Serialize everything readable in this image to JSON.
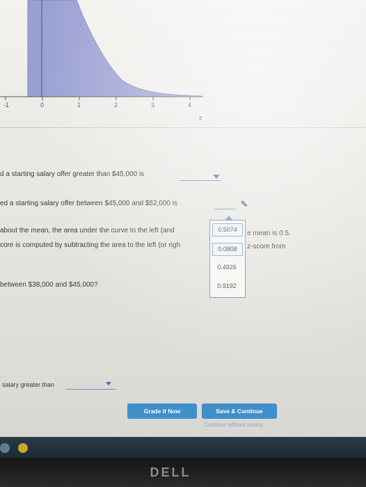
{
  "chart": {
    "tick_labels": [
      "-1",
      "0",
      "1",
      "2",
      "3",
      "4"
    ],
    "axis_var": "z",
    "fill_color": "#9aa0d3"
  },
  "questions": {
    "q_greater_45000": "d a starting salary offer greater than $45,000 is",
    "q_between_45000_52000": "ed a starting salary offer between $45,000 and $52,000 is",
    "hint_line1_left": "about the mean, the area under the curve to the left (and",
    "hint_line1_right": "e mean is 0.5.",
    "hint_line2_left": "core is computed by subtracting the area to the left (or righ",
    "hint_line2_right": "z-score from",
    "q_between_38000_45000": "between $38,000 and $45,000?",
    "q_salary_greater_than": "salary greater than"
  },
  "dropdown": {
    "options": [
      "0.5074",
      "0.0808",
      "0.4926",
      "0.9192"
    ],
    "highlight_color": "#7f9fca"
  },
  "buttons": {
    "grade_now": "Grade It Now",
    "save_continue": "Save & Continue",
    "continue_without_saving": "Continue without saving",
    "accent": "#3f8fc9"
  },
  "monitor": {
    "brand": "DELL"
  }
}
